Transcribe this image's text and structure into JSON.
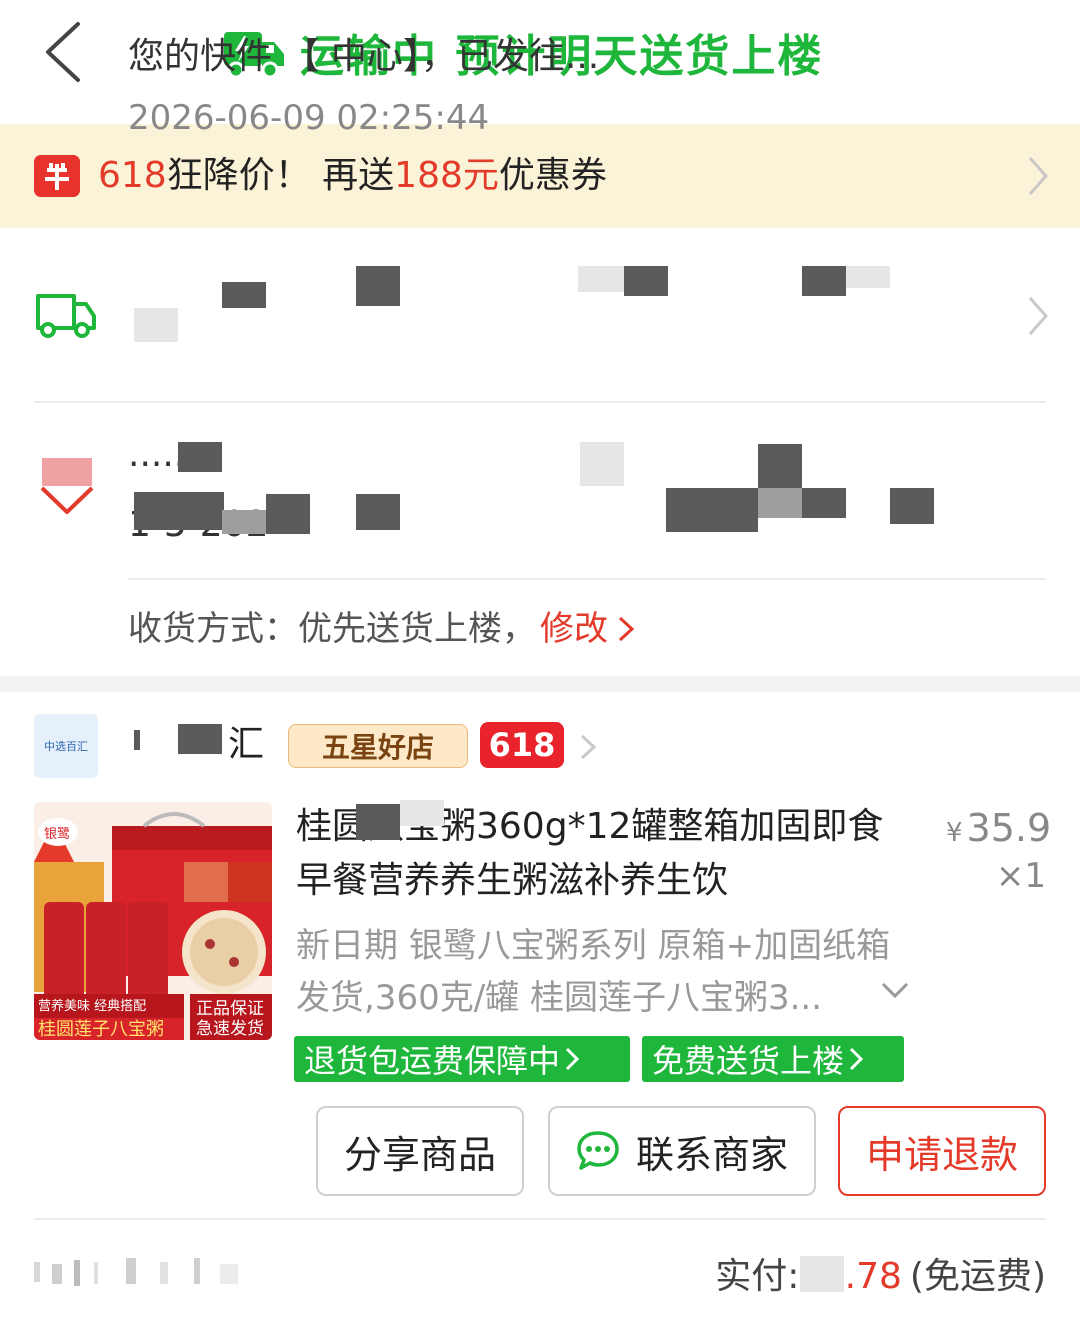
{
  "header": {
    "status_title": "运输中 预计明天送货上楼",
    "accent_color": "#1fb63c",
    "back_icon": "back-chevron-icon",
    "status_icon": "delivery-truck-icon"
  },
  "promo": {
    "part1": "618",
    "part2": "狂降价！ 再送",
    "part3": "188元",
    "part4": "优惠券",
    "highlight_color": "#e33a2a"
  },
  "logistics": {
    "message": "您的快件     【        中心】，已发往...",
    "time": "2026-06-09 02:25:44"
  },
  "address": {
    "line1": "              ......",
    "line2": "                             1-5-202",
    "delivery_label": "收货方式：优先送货上楼，",
    "modify_label": "修改"
  },
  "shop": {
    "logo_text": "中选百汇",
    "name": "汇",
    "star_badge": "五星好店",
    "campaign_badge": "618"
  },
  "product": {
    "title": "  桂圆八宝粥360g*12罐整箱加固即食早餐营养养生粥滋补养生饮",
    "price_symbol": "¥",
    "price": "35.9",
    "quantity": "×1",
    "spec": "新日期 银鹭八宝粥系列 原箱+加固纸箱发货,360克/罐 桂圆莲子八宝粥3...",
    "tags": [
      "退货包运费保障中",
      "免费送货上楼"
    ],
    "image_brand": "银鹭",
    "image_caption_1": "营养美味 经典搭配",
    "image_caption_2": "桂圆莲子八宝粥",
    "image_caption_3": "正品保证",
    "image_caption_4": "急速发货"
  },
  "actions": {
    "share": "分享商品",
    "contact": "联系商家",
    "refund": "申请退款"
  },
  "footer": {
    "paid_label": "实付:",
    "paid_symbol": "¥",
    "paid_amount": "  .78",
    "shipping_note": "(免运费)"
  }
}
